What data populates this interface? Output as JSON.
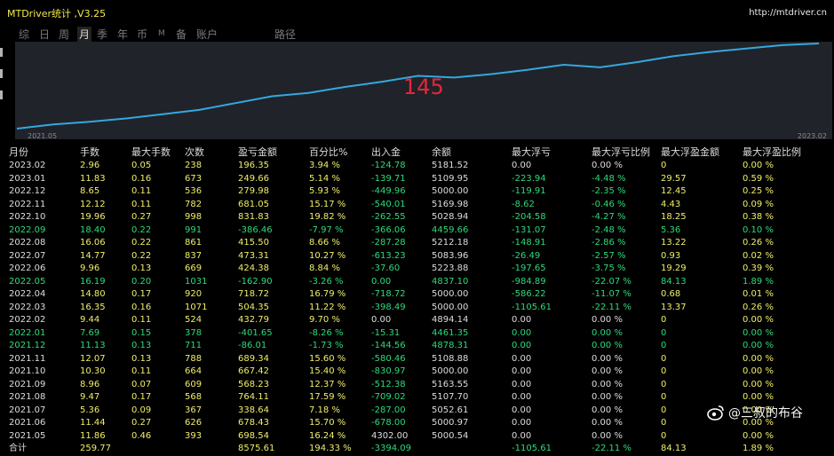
{
  "window": {
    "title": "MTDriver统计 ,V3.25",
    "url": "http://mtdriver.cn"
  },
  "toolbar": {
    "items": [
      "综",
      "日",
      "周",
      "月",
      "季",
      "年",
      "币",
      "M",
      "备",
      "账户",
      "路径"
    ],
    "active": "月"
  },
  "chart": {
    "x_start_label": "2021.05",
    "x_end_label": "2023.02",
    "count_label": "145",
    "line_color": "#34a8de",
    "points": [
      0.0,
      0.05,
      0.08,
      0.12,
      0.17,
      0.22,
      0.3,
      0.38,
      0.42,
      0.49,
      0.55,
      0.62,
      0.6,
      0.64,
      0.69,
      0.75,
      0.72,
      0.78,
      0.85,
      0.9,
      0.94,
      0.98,
      1.0
    ]
  },
  "table": {
    "headers": [
      "月份",
      "手数",
      "最大手数",
      "次数",
      "盈亏金额",
      "百分比%",
      "出入金",
      "余额",
      "最大浮亏",
      "最大浮亏比例",
      "最大浮盈金额",
      "最大浮盈比例"
    ],
    "rows": [
      [
        "2023.02",
        "2.96",
        "0.05",
        "238",
        "196.35",
        "3.94 %",
        "-124.78",
        "5181.52",
        "0.00",
        "0.00 %",
        "0",
        "0.00 %"
      ],
      [
        "2023.01",
        "11.83",
        "0.16",
        "673",
        "249.66",
        "5.14 %",
        "-139.71",
        "5109.95",
        "-223.94",
        "-4.48 %",
        "29.57",
        "0.59 %"
      ],
      [
        "2022.12",
        "8.65",
        "0.11",
        "536",
        "279.98",
        "5.93 %",
        "-449.96",
        "5000.00",
        "-119.91",
        "-2.35 %",
        "12.45",
        "0.25 %"
      ],
      [
        "2022.11",
        "12.12",
        "0.11",
        "782",
        "681.05",
        "15.17 %",
        "-540.01",
        "5169.98",
        "-8.62",
        "-0.46 %",
        "4.43",
        "0.09 %"
      ],
      [
        "2022.10",
        "19.96",
        "0.27",
        "998",
        "831.83",
        "19.82 %",
        "-262.55",
        "5028.94",
        "-204.58",
        "-4.27 %",
        "18.25",
        "0.38 %"
      ],
      [
        "2022.09",
        "18.40",
        "0.22",
        "991",
        "-386.46",
        "-7.97 %",
        "-366.06",
        "4459.66",
        "-131.07",
        "-2.48 %",
        "5.36",
        "0.10 %"
      ],
      [
        "2022.08",
        "16.06",
        "0.22",
        "861",
        "415.50",
        "8.66 %",
        "-287.28",
        "5212.18",
        "-148.91",
        "-2.86 %",
        "13.22",
        "0.26 %"
      ],
      [
        "2022.07",
        "14.77",
        "0.22",
        "837",
        "473.31",
        "10.27 %",
        "-613.23",
        "5083.96",
        "-26.49",
        "-2.57 %",
        "0.93",
        "0.02 %"
      ],
      [
        "2022.06",
        "9.96",
        "0.13",
        "669",
        "424.38",
        "8.84 %",
        "-37.60",
        "5223.88",
        "-197.65",
        "-3.75 %",
        "19.29",
        "0.39 %"
      ],
      [
        "2022.05",
        "16.19",
        "0.20",
        "1031",
        "-162.90",
        "-3.26 %",
        "0.00",
        "4837.10",
        "-984.89",
        "-22.07 %",
        "84.13",
        "1.89 %"
      ],
      [
        "2022.04",
        "14.80",
        "0.17",
        "920",
        "718.72",
        "16.79 %",
        "-718.72",
        "5000.00",
        "-586.22",
        "-11.07 %",
        "0.68",
        "0.01 %"
      ],
      [
        "2022.03",
        "16.35",
        "0.16",
        "1071",
        "504.35",
        "11.22 %",
        "-398.49",
        "5000.00",
        "-1105.61",
        "-22.11 %",
        "13.37",
        "0.26 %"
      ],
      [
        "2022.02",
        "9.44",
        "0.11",
        "524",
        "432.79",
        "9.70 %",
        "0.00",
        "4894.14",
        "0.00",
        "0.00 %",
        "0",
        "0.00 %"
      ],
      [
        "2022.01",
        "7.69",
        "0.15",
        "378",
        "-401.65",
        "-8.26 %",
        "-15.31",
        "4461.35",
        "0.00",
        "0.00 %",
        "0",
        "0.00 %"
      ],
      [
        "2021.12",
        "11.13",
        "0.13",
        "711",
        "-86.01",
        "-1.73 %",
        "-144.56",
        "4878.31",
        "0.00",
        "0.00 %",
        "0",
        "0.00 %"
      ],
      [
        "2021.11",
        "12.07",
        "0.13",
        "788",
        "689.34",
        "15.60 %",
        "-580.46",
        "5108.88",
        "0.00",
        "0.00 %",
        "0",
        "0.00 %"
      ],
      [
        "2021.10",
        "10.30",
        "0.11",
        "664",
        "667.42",
        "15.40 %",
        "-830.97",
        "5000.00",
        "0.00",
        "0.00 %",
        "0",
        "0.00 %"
      ],
      [
        "2021.09",
        "8.96",
        "0.07",
        "609",
        "568.23",
        "12.37 %",
        "-512.38",
        "5163.55",
        "0.00",
        "0.00 %",
        "0",
        "0.00 %"
      ],
      [
        "2021.08",
        "9.47",
        "0.17",
        "568",
        "764.11",
        "17.59 %",
        "-709.02",
        "5107.70",
        "0.00",
        "0.00 %",
        "0",
        "0.00 %"
      ],
      [
        "2021.07",
        "5.36",
        "0.09",
        "367",
        "338.64",
        "7.18 %",
        "-287.00",
        "5052.61",
        "0.00",
        "0.00 %",
        "0",
        "0.00 %"
      ],
      [
        "2021.06",
        "11.44",
        "0.27",
        "626",
        "678.43",
        "15.70 %",
        "-678.00",
        "5000.97",
        "0.00",
        "0.00 %",
        "0",
        "0.00 %"
      ],
      [
        "2021.05",
        "11.86",
        "0.46",
        "393",
        "698.54",
        "16.24 %",
        "4302.00",
        "5000.54",
        "0.00",
        "0.00 %",
        "0",
        "0.00 %"
      ]
    ],
    "total": [
      "合计",
      "259.77",
      "",
      "",
      "8575.61",
      "194.33 %",
      "-3394.09",
      "",
      "-1105.61",
      "-22.11 %",
      "84.13",
      "1.89 %"
    ]
  },
  "watermark": {
    "text": "@三叔的布谷"
  },
  "colors": {
    "positive": "#f0ee6a",
    "negative": "#2fd97a",
    "neutral": "#dddddd",
    "title": "#f2e94a",
    "counter": "#e5263a"
  }
}
